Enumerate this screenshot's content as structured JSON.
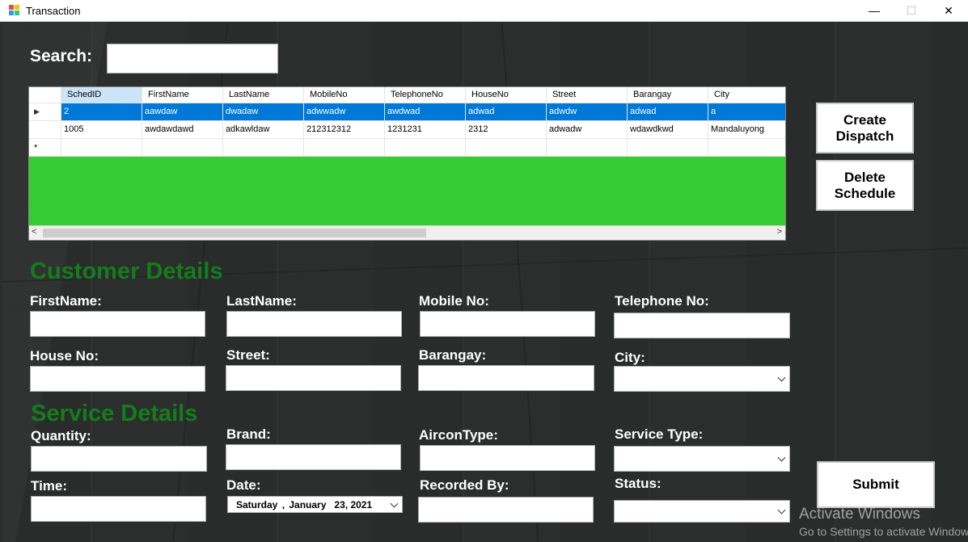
{
  "window": {
    "title": "Transaction",
    "minimize": "—",
    "maximize": "☐",
    "close": "✕"
  },
  "search": {
    "label": "Search:",
    "value": ""
  },
  "grid": {
    "columns": [
      "SchedID",
      "FirstName",
      "LastName",
      "MobileNo",
      "TelephoneNo",
      "HouseNo",
      "Street",
      "Barangay",
      "City"
    ],
    "rows": [
      [
        "2",
        "aawdaw",
        "dwadaw",
        "adwwadw",
        "awdwad",
        "adwad",
        "adwdw",
        "adwad",
        "a"
      ],
      [
        "1005",
        "awdawdawd",
        "adkawldaw",
        "212312312",
        "1231231",
        "2312",
        "adwadw",
        "wdawdkwd",
        "Mandaluyong"
      ]
    ],
    "selected_row": 0,
    "new_row_marker": "*",
    "current_row_marker": "▶",
    "scroll_left": "<",
    "scroll_right": ">"
  },
  "buttons": {
    "create_dispatch": "Create Dispatch",
    "delete_schedule": "Delete Schedule",
    "submit": "Submit"
  },
  "customer": {
    "heading": "Customer Details",
    "firstname": "FirstName:",
    "lastname": "LastName:",
    "mobile": "Mobile No:",
    "telephone": "Telephone No:",
    "house": "House No:",
    "street": "Street:",
    "barangay": "Barangay:",
    "city": "City:"
  },
  "service": {
    "heading": "Service Details",
    "quantity": "Quantity:",
    "brand": "Brand:",
    "aircon_type": "AirconType:",
    "service_type": "Service Type:",
    "time": "Time:",
    "date": "Date:",
    "recorded_by": "Recorded By:",
    "status": "Status:",
    "date_value": {
      "weekday": "Saturday",
      "sep": ",",
      "month": "January",
      "day": "23,",
      "year": "2021"
    }
  },
  "watermark": {
    "line1": "Activate Windows",
    "line2": "Go to Settings to activate Windows."
  },
  "colors": {
    "heading_green": "#137d1b",
    "grid_bg": "#33cc33",
    "selection": "#0078d7"
  }
}
